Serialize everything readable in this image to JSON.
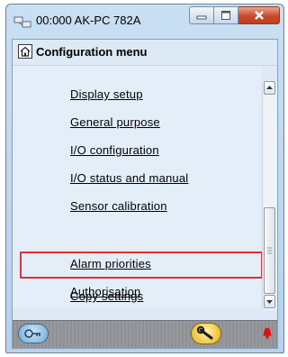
{
  "window": {
    "title": "00:000 AK-PC 782A"
  },
  "menu": {
    "title": "Configuration menu",
    "items": [
      {
        "label": "Display setup"
      },
      {
        "label": "General purpose"
      },
      {
        "label": "I/O configuration"
      },
      {
        "label": "I/O status and manual"
      },
      {
        "label": "Sensor calibration"
      },
      {
        "label": "Alarm priorities",
        "highlighted": true
      },
      {
        "label": "Authorisation"
      },
      {
        "label": "Copy settings"
      }
    ]
  },
  "icons": {
    "app": "network-icon",
    "home": "home-icon",
    "footer_left": "logout-icon",
    "footer_tool": "wrench-icon",
    "footer_alarm": "alarm-bell-icon"
  },
  "colors": {
    "highlight_border": "#d9333a",
    "close_button": "#c8492c",
    "alarm": "#e01010"
  }
}
